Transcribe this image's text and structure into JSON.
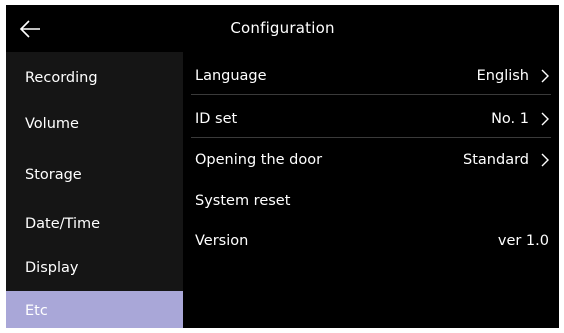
{
  "header": {
    "title": "Configuration",
    "back_icon": "arrow-left-icon"
  },
  "sidebar": {
    "items": [
      {
        "label": "Recording",
        "active": false
      },
      {
        "label": "Volume",
        "active": false
      },
      {
        "label": "Storage",
        "active": false
      },
      {
        "label": "Date/Time",
        "active": false
      },
      {
        "label": "Display",
        "active": false
      },
      {
        "label": "Etc",
        "active": true
      }
    ]
  },
  "settings": {
    "rows": [
      {
        "label": "Language",
        "value": "English",
        "has_arrow": true
      },
      {
        "label": "ID set",
        "value": "No. 1",
        "has_arrow": true
      },
      {
        "label": "Opening the door",
        "value": "Standard",
        "has_arrow": true
      },
      {
        "label": "System reset",
        "value": "",
        "has_arrow": false
      },
      {
        "label": "Version",
        "value": "ver 1.0",
        "has_arrow": false
      }
    ]
  },
  "colors": {
    "background": "#000000",
    "sidebar_bg": "#151515",
    "active_item": "#a9a7d8",
    "text": "#ffffff",
    "divider": "#3a3a3a"
  }
}
